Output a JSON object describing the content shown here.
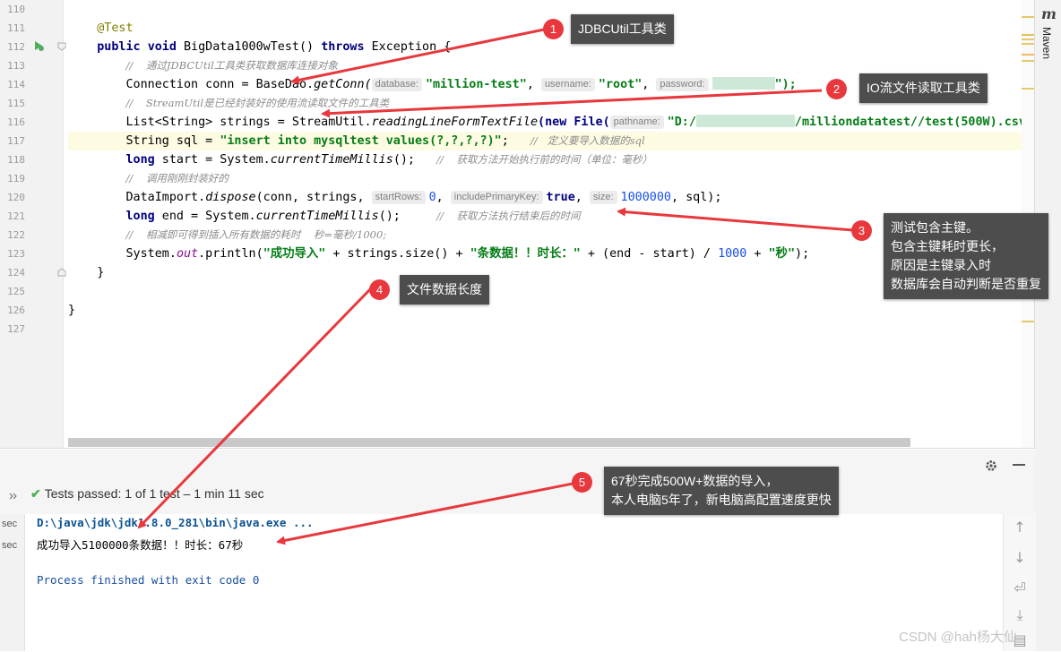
{
  "line_numbers": [
    "110",
    "111",
    "112",
    "113",
    "114",
    "115",
    "116",
    "117",
    "118",
    "119",
    "120",
    "121",
    "122",
    "123",
    "124",
    "125",
    "126",
    "127"
  ],
  "code": {
    "l111_annotation": "@Test",
    "l112_public": "public",
    "l112_void": "void",
    "l112_name": "BigData1000wTest() ",
    "l112_throws": "throws",
    "l112_rest": " Exception {",
    "l113_comment": "//    通过JDBCUtil工具类获取数据库连接对象",
    "l114_pre": "Connection conn = BaseDao.",
    "l114_method": "getConn(",
    "l114_hint_db": "database:",
    "l114_db": "\"million-test\"",
    "l114_sep1": ", ",
    "l114_hint_user": "username:",
    "l114_user": "\"root\"",
    "l114_sep2": ", ",
    "l114_hint_pw": "password:",
    "l114_end": "\");",
    "l115_comment": "//    StreamUtil是已经封装好的使用流读取文件的工具类",
    "l116_pre": "List<String> strings = StreamUtil.",
    "l116_method": "readingLineFormTextFile",
    "l116_new": "(new File(",
    "l116_hint": "pathname:",
    "l116_path_a": "\"D:/",
    "l116_path_b": "/milliondatatest//test(500W).csv\"",
    "l117_pre": "String sql = ",
    "l117_str": "\"insert into mysqltest values(?,?,?,?)\"",
    "l117_semi": ";   ",
    "l117_comment": "//   定义要导入数据的sql",
    "l118_long": "long",
    "l118_pre": " start = System.",
    "l118_method": "currentTimeMillis",
    "l118_post": "();   ",
    "l118_comment": "//    获取方法开始执行前的时间（单位：毫秒）",
    "l119_comment": "//    调用刚刚封装好的",
    "l120_pre": "DataImport.",
    "l120_method": "dispose",
    "l120_args": "(conn, strings, ",
    "l120_hint_start": "startRows:",
    "l120_start": "0",
    "l120_sep": ", ",
    "l120_hint_pk": "includePrimaryKey:",
    "l120_pk": "true",
    "l120_sep2": ", ",
    "l120_hint_size": "size:",
    "l120_size": "1000000",
    "l120_end": ", sql);",
    "l121_long": "long",
    "l121_pre": " end = System.",
    "l121_method": "currentTimeMillis",
    "l121_post": "();     ",
    "l121_comment": "//    获取方法执行结束后的时间",
    "l122_comment": "//    相减即可得到插入所有数据的耗时    秒=毫秒/1000;",
    "l123_pre": "System.",
    "l123_out": "out",
    "l123_println": ".println(",
    "l123_s1": "\"成功导入\"",
    "l123_mid": " + strings.size() + ",
    "l123_s2": "\"条数据！！时长：\"",
    "l123_mid2": " + (end - start) / ",
    "l123_num": "1000",
    "l123_mid3": " + ",
    "l123_s3": "\"秒\"",
    "l123_end": ");",
    "l124": "}",
    "l126": "}"
  },
  "right_bar": {
    "maven_icon": "m",
    "maven_label": "Maven"
  },
  "tests": {
    "status": "Tests passed:",
    "detail": "1 of 1 test – 1 min 11 sec"
  },
  "console": {
    "cmd": "D:\\java\\jdk\\jdk1.8.0_281\\bin\\java.exe ...",
    "output": "成功导入5100000条数据！！时长：67秒",
    "finished": "Process finished with exit code 0",
    "side_labels": [
      "sec",
      "sec"
    ]
  },
  "callouts": [
    {
      "num": "1",
      "text": "JDBCUtil工具类"
    },
    {
      "num": "2",
      "text": "IO流文件读取工具类"
    },
    {
      "num": "3",
      "text": "测试包含主键。\n包含主键耗时更长，\n原因是主键录入时\n数据库会自动判断是否重复"
    },
    {
      "num": "4",
      "text": "文件数据长度"
    },
    {
      "num": "5",
      "text": "67秒完成500W+数据的导入，\n本人电脑5年了，新电脑高配置速度更快"
    }
  ],
  "watermark": "CSDN @hah杨大仙",
  "colors": {
    "callout_bg": "#4d4d4d",
    "badge": "#e8383d",
    "arrow": "#e8383d"
  }
}
